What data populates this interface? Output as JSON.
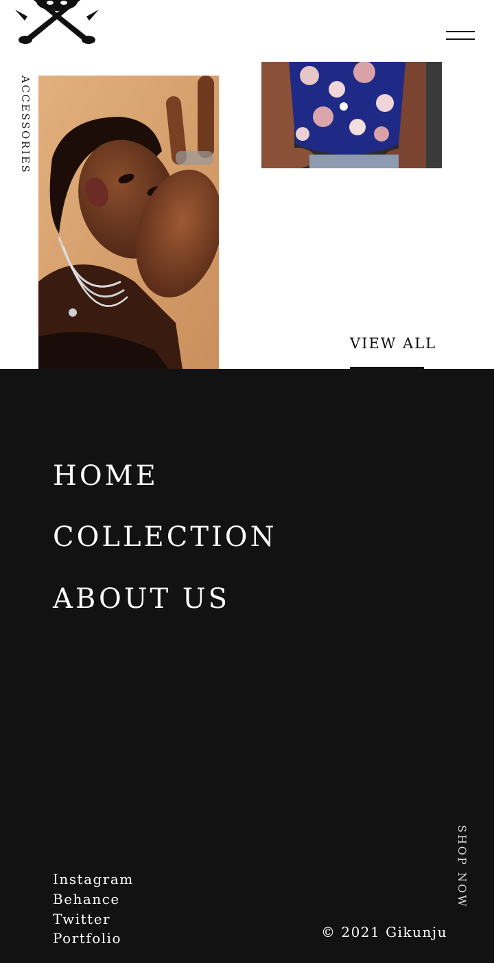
{
  "header": {
    "logo_icon": "crossed-swords-skull-logo",
    "menu_icon": "hamburger-menu-icon"
  },
  "featured": {
    "category_label": "ACCESSORIES",
    "view_all_label": "VIEW ALL"
  },
  "footer": {
    "nav": [
      "HOME",
      "COLLECTION",
      "ABOUT US"
    ],
    "social": [
      "Instagram",
      "Behance",
      "Twitter",
      "Portfolio"
    ],
    "copyright": "© 2021 Gikunju",
    "shop_now": "SHOP NOW"
  },
  "colors": {
    "footer_bg": "#121212",
    "text_dark": "#111111",
    "text_light": "#ffffff"
  }
}
